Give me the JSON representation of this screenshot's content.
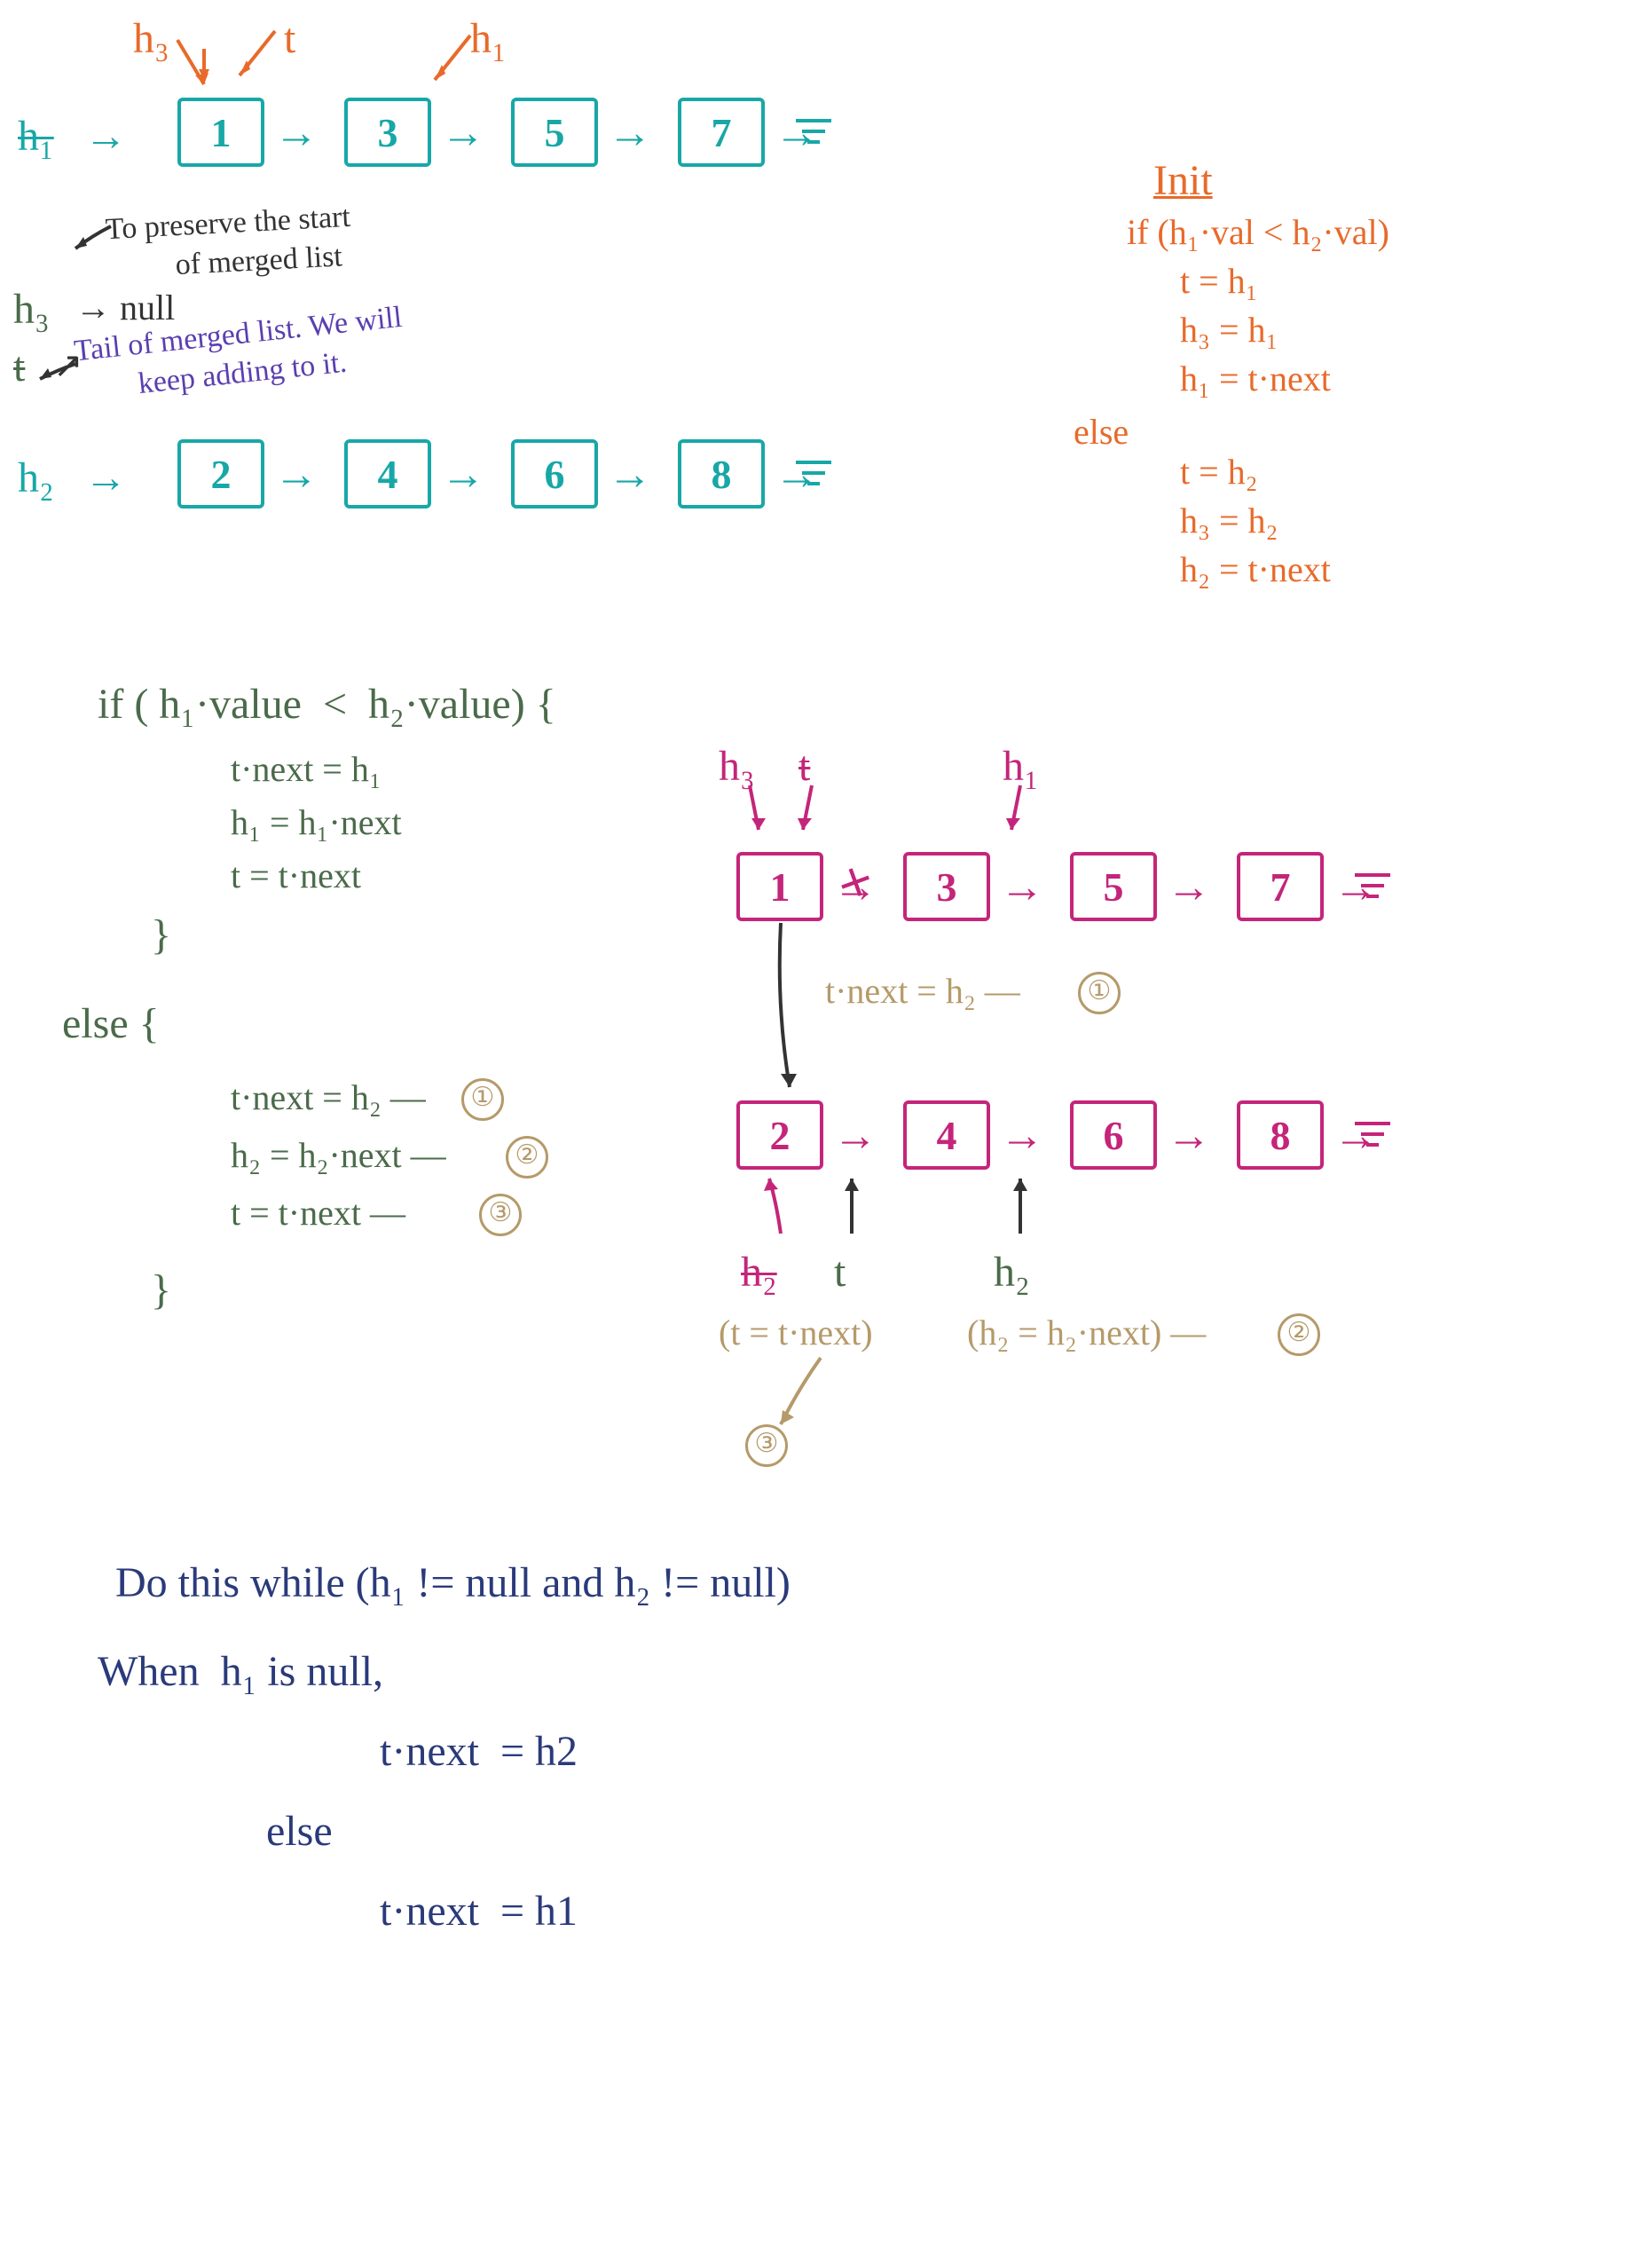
{
  "top": {
    "labels": {
      "h3": "h₃",
      "t": "t",
      "h1_new": "h₁",
      "h1_old": "h₁",
      "h1_arrow": "→",
      "h2": "h₂",
      "h2_arrow": "→",
      "h3_null_label": "h₃",
      "h3_null_arrow": "→ null",
      "t_label": "t",
      "t_arrow": "↗"
    },
    "list1": [
      "1",
      "3",
      "5",
      "7"
    ],
    "list2": [
      "2",
      "4",
      "6",
      "8"
    ],
    "annotation_preserve": "To preserve the start\n         of merged list",
    "annotation_tail": "Tail of merged list. We will\n        keep adding to it."
  },
  "init": {
    "title": "Init",
    "line1": "if (h₁·val < h₂·val)",
    "line2": "    t = h₁",
    "line3": "    h₃ = h₁",
    "line4": "    h₁ = t·next",
    "line5": "else",
    "line6": "    t = h₂",
    "line7": "    h₃ = h₂",
    "line8": "    h₂ = t·next"
  },
  "code": {
    "line1": "if ( h₁·value  <  h₂·value) {",
    "line2": "        t·next = h₁",
    "line3": "        h₁ = h₁·next",
    "line4": "        t = t·next",
    "line5": "}",
    "line6": "else {",
    "line7": "        t·next = h₂ —",
    "line7n": "①",
    "line8": "        h₂ = h₂·next —",
    "line8n": "②",
    "line9": "        t = t·next —",
    "line9n": "③",
    "line10": "}"
  },
  "diagram2": {
    "labels": {
      "h3": "h₃",
      "t_strike": "t",
      "h1": "h₁",
      "h2_strike": "h₂",
      "t": "t",
      "h2": "h₂"
    },
    "list1": [
      "1",
      "3",
      "5",
      "7"
    ],
    "list2": [
      "2",
      "4",
      "6",
      "8"
    ],
    "ann_tnext": "t·next = h₂ —",
    "ann_tnext_n": "①",
    "ann_t_eq": "(t = t·next)",
    "ann_h2_eq": "(h₂ = h₂·next) —",
    "ann_h2_n": "②",
    "ann_three": "③"
  },
  "bottom": {
    "line1": "Do this while (h₁ != null and h₂ != null)",
    "line2": "When  h₁ is null,",
    "line3": "              t·next  = h2",
    "line4": "     else",
    "line5": "              t·next  = h1"
  }
}
